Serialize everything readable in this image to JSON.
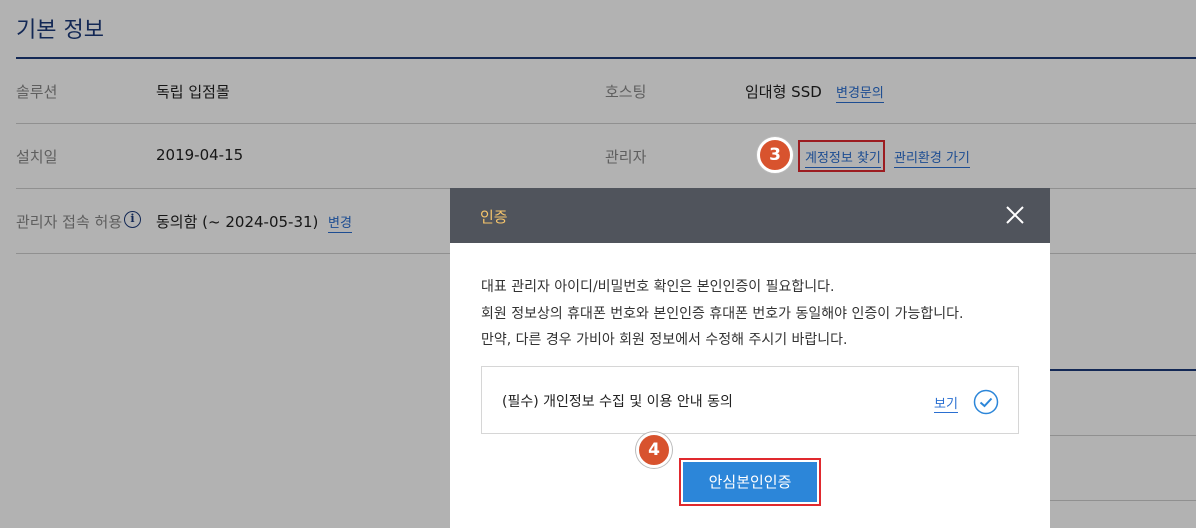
{
  "section": {
    "title": "기본 정보"
  },
  "rows": {
    "solution": {
      "label": "솔루션",
      "value": "독립 입점몰"
    },
    "hosting": {
      "label": "호스팅",
      "value": "임대형 SSD",
      "link": "변경문의"
    },
    "install_date": {
      "label": "설치일",
      "value": "2019-04-15"
    },
    "admin": {
      "label": "관리자",
      "link_account": "계정정보 찾기",
      "link_admin_env": "관리환경 가기"
    },
    "admin_access": {
      "label": "관리자 접속 허용",
      "info_icon": "info-icon",
      "value": "동의함 (~ 2024-05-31)",
      "link": "변경"
    }
  },
  "annotations": {
    "step3": "3",
    "step4": "4",
    "highlight_color": "#e0292e",
    "badge_color": "#d8532e"
  },
  "modal": {
    "title": "인증",
    "close_icon": "close-icon",
    "description": [
      "대표 관리자 아이디/비밀번호 확인은 본인인증이 필요합니다.",
      "회원 정보상의 휴대폰 번호와 본인인증 휴대폰 번호가 동일해야 인증이 가능합니다.",
      "만약, 다른 경우 가비아 회원 정보에서 수정해 주시기 바랍니다."
    ],
    "consent": {
      "text": "(필수) 개인정보 수집 및 이용 안내 동의",
      "view_link": "보기",
      "check_icon": "check-circle-icon"
    },
    "primary_button": "안심본인인증",
    "header_color": "#50545c",
    "button_color": "#2c86d9"
  }
}
